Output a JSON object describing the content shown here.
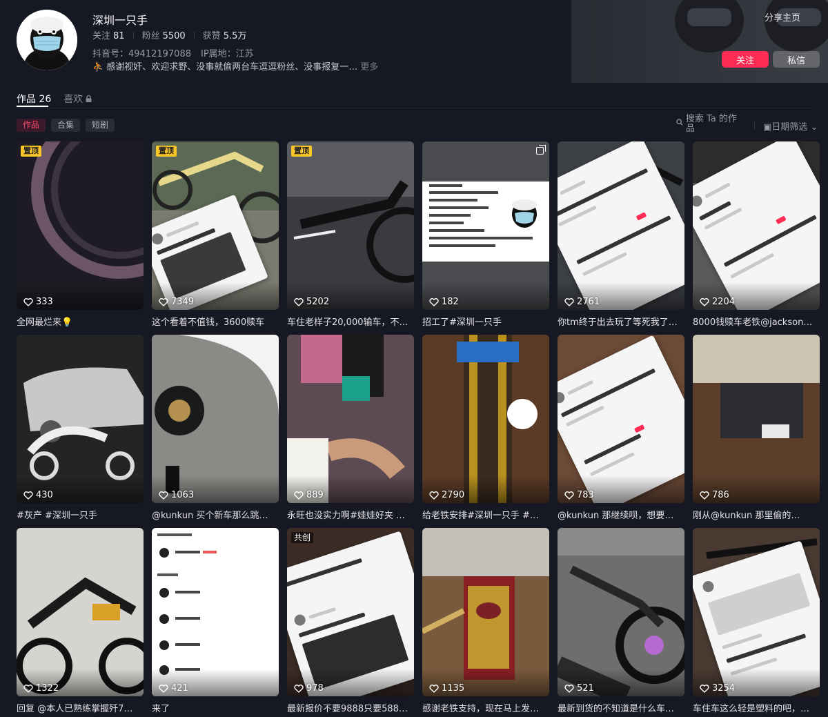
{
  "profile": {
    "nickname": "深圳一只手",
    "following_label": "关注",
    "following_count": "81",
    "followers_label": "粉丝",
    "followers_count": "5500",
    "likes_label": "获赞",
    "likes_count": "5.5万",
    "douyin_id": "抖音号：49412197088",
    "ip_location": "IP属地：江苏",
    "bio": "感谢视奸、欢迎求野、没事就偷两台车逗逗粉丝、没事报复一…",
    "bio_more": "更多"
  },
  "header": {
    "share_label": "分享主页",
    "follow_label": "关注",
    "message_label": "私信"
  },
  "tabs": {
    "works_label": "作品 26",
    "likes_label": "喜欢"
  },
  "subtabs": [
    {
      "label": "作品"
    },
    {
      "label": "合集"
    },
    {
      "label": "短剧"
    }
  ],
  "tools": {
    "search_label": "搜索 Ta 的作品",
    "date_filter_label": "日期筛选"
  },
  "colors": {
    "background": "#161823",
    "accent": "#fe2c55",
    "pin_badge": "#f8c629"
  },
  "videos": [
    {
      "likes": "333",
      "caption": "全网最烂来💡",
      "badge": "置顶",
      "multi": false
    },
    {
      "likes": "7349",
      "caption": "这个看着不值钱，3600赎车",
      "badge": "置顶",
      "multi": false
    },
    {
      "likes": "5202",
      "caption": "车住老样子20,000输车，不…",
      "badge": "置顶",
      "multi": false
    },
    {
      "likes": "182",
      "caption": "招工了#深圳一只手",
      "badge": "",
      "multi": true
    },
    {
      "likes": "2761",
      "caption": "你tm终于出去玩了等死我了…",
      "badge": "",
      "multi": false
    },
    {
      "likes": "2204",
      "caption": "8000钱赎车老铁@jackson…",
      "badge": "",
      "multi": false
    },
    {
      "likes": "430",
      "caption": "#灰产 #深圳一只手",
      "badge": "",
      "multi": false
    },
    {
      "likes": "1063",
      "caption": "@kunkun 买个新车那么跳…",
      "badge": "",
      "multi": false
    },
    {
      "likes": "889",
      "caption": "永旺也没实力啊#娃娃好夹 …",
      "badge": "",
      "multi": false
    },
    {
      "likes": "2790",
      "caption": "给老铁安排#深圳一只手 #…",
      "badge": "",
      "multi": false
    },
    {
      "likes": "783",
      "caption": "@kunkun 那继续呗，想要…",
      "badge": "",
      "multi": false
    },
    {
      "likes": "786",
      "caption": "刚从@kunkun 那里偷的…",
      "badge": "",
      "multi": false
    },
    {
      "likes": "1322",
      "caption": "回复 @本人已熟练掌握歼7…",
      "badge": "",
      "multi": false
    },
    {
      "likes": "421",
      "caption": "来了",
      "badge": "",
      "multi": true
    },
    {
      "likes": "978",
      "caption": "最新报价不要9888只要588…",
      "badge": "共创",
      "multi": false
    },
    {
      "likes": "1135",
      "caption": "感谢老铁支持，现在马上发…",
      "badge": "",
      "multi": false
    },
    {
      "likes": "521",
      "caption": "最新到货的不知道是什么车…",
      "badge": "",
      "multi": false
    },
    {
      "likes": "3254",
      "caption": "车住车这么轻是塑料的吧，…",
      "badge": "",
      "multi": false
    }
  ]
}
